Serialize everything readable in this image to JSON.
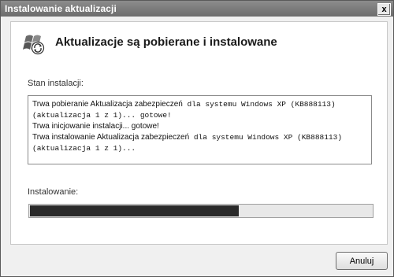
{
  "window": {
    "title": "Instalowanie aktualizacji",
    "close_label": "x"
  },
  "header": {
    "icon": "windows-update-icon",
    "title": "Aktualizacje są pobierane i instalowane"
  },
  "status": {
    "label": "Stan instalacji:",
    "lines": [
      {
        "sans": "Trwa pobieranie Aktualizacja zabezpieczeń",
        "mono": " dla systemu Windows XP (KB888113)"
      },
      {
        "sans": "",
        "mono": "(aktualizacja 1 z 1)... gotowe!"
      },
      {
        "sans": "Trwa inicjowanie instalacji... gotowe!",
        "mono": ""
      },
      {
        "sans": "Trwa instalowanie Aktualizacja zabezpieczeń",
        "mono": " dla systemu Windows XP (KB888113)"
      },
      {
        "sans": "",
        "mono": "(aktualizacja 1 z 1)..."
      }
    ]
  },
  "progress": {
    "label": "Instalowanie:",
    "fraction": 0.61,
    "fill_color": "#2a2a2a"
  },
  "buttons": {
    "cancel_label": "Anuluj"
  }
}
